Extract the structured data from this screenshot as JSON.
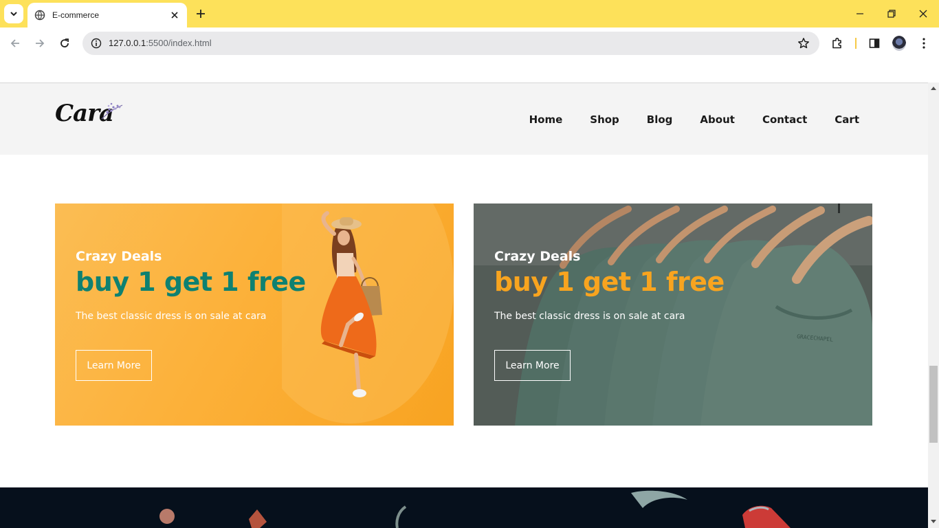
{
  "browser": {
    "tab_title": "E-commerce",
    "url_host": "127.0.0.1",
    "url_path": ":5500/index.html"
  },
  "site": {
    "logo": "Cara",
    "nav": [
      "Home",
      "Shop",
      "Blog",
      "About",
      "Contact",
      "Cart"
    ]
  },
  "banners": [
    {
      "kicker": "Crazy Deals",
      "headline": "buy 1 get 1 free",
      "subtitle": "The best classic dress is on sale at cara",
      "button": "Learn More",
      "headline_color": "#0e8171"
    },
    {
      "kicker": "Crazy Deals",
      "headline": "buy 1 get 1 free",
      "subtitle": "The best classic dress is on sale at cara",
      "button": "Learn More",
      "headline_color": "#f8a41f"
    }
  ],
  "colors": {
    "tabstrip": "#fde15a",
    "header_bg": "#f4f4f4",
    "banner_orange": "#fcb13a",
    "banner_teal_shirt": "#5c7a70",
    "footer_dark": "#06101c"
  }
}
